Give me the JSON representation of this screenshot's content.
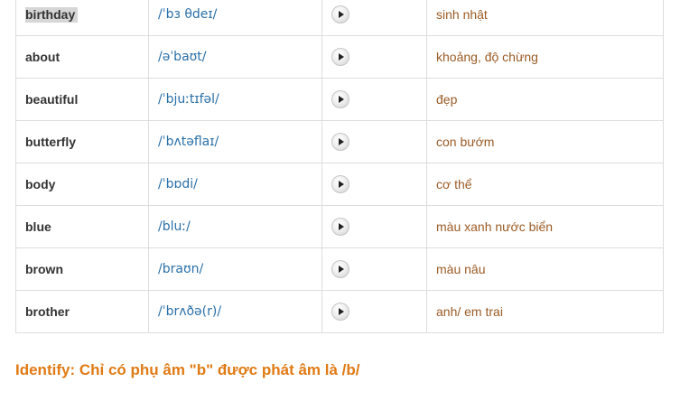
{
  "rows": [
    {
      "word": "birthday",
      "ipa": "/ˈbɜ θdeɪ/",
      "meaning": "sinh nhật"
    },
    {
      "word": "about",
      "ipa": "/əˈbaʊt/",
      "meaning": "khoảng, độ chừng"
    },
    {
      "word": "beautiful",
      "ipa": "/ˈbjuːtɪfəl/",
      "meaning": "đẹp"
    },
    {
      "word": "butterfly",
      "ipa": "/ˈbʌtəflaɪ/",
      "meaning": "con bướm"
    },
    {
      "word": "body",
      "ipa": "/ˈbɒdi/",
      "meaning": "cơ thể"
    },
    {
      "word": "blue",
      "ipa": "/bluː/",
      "meaning": "màu xanh nước biển"
    },
    {
      "word": "brown",
      "ipa": "/braʊn/",
      "meaning": "màu nâu"
    },
    {
      "word": "brother",
      "ipa": "/ˈbrʌðə(r)/",
      "meaning": "anh/ em trai"
    }
  ],
  "identify_text": "Identify: Chỉ có phụ âm \"b\" được phát âm là /b/",
  "colors": {
    "ipa": "#2a6fa8",
    "meaning": "#9a5b26",
    "identify": "#e07a14",
    "highlight": "#d6d6d6"
  }
}
